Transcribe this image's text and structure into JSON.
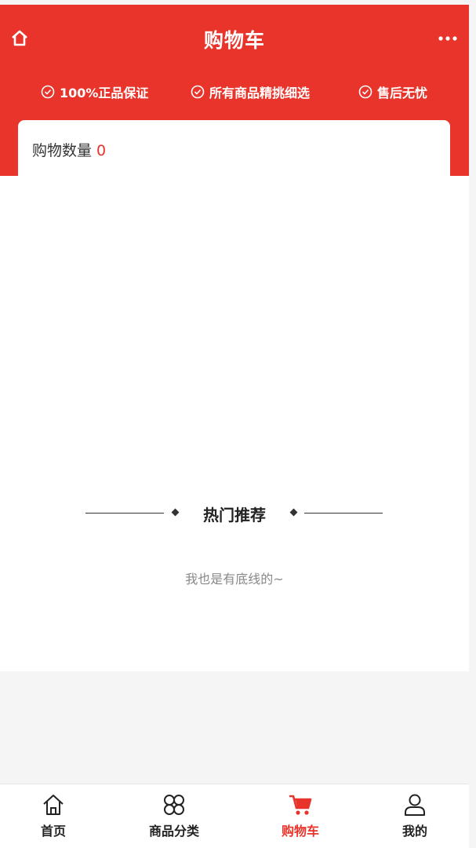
{
  "header": {
    "title": "购物车",
    "guarantees": [
      "100%正品保证",
      "所有商品精挑细选",
      "售后无忧"
    ]
  },
  "cart": {
    "count_label": "购物数量",
    "count_value": "0"
  },
  "recommend": {
    "title": "热门推荐",
    "end_text": "我也是有底线的~"
  },
  "tabbar": {
    "items": [
      {
        "label": "首页",
        "icon": "home-icon"
      },
      {
        "label": "商品分类",
        "icon": "category-icon"
      },
      {
        "label": "购物车",
        "icon": "cart-icon"
      },
      {
        "label": "我的",
        "icon": "user-icon"
      }
    ],
    "active": "购物车"
  },
  "colors": {
    "brand": "#e8342a",
    "text": "#222222",
    "muted": "#888888"
  }
}
